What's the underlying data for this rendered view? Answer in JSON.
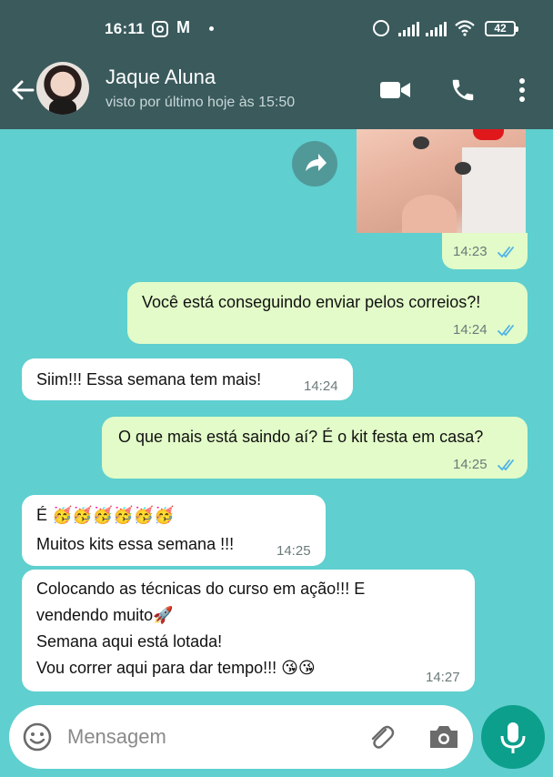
{
  "statusbar": {
    "time": "16:11",
    "mail_glyph": "M",
    "battery": "42"
  },
  "header": {
    "contact_name": "Jaque Aluna",
    "last_seen": "visto por último hoje às 15:50"
  },
  "messages": [
    {
      "type": "image",
      "direction": "out",
      "time": "14:23",
      "ticks": "read"
    },
    {
      "type": "text",
      "direction": "out",
      "text": "Você está conseguindo enviar pelos correios?!",
      "time": "14:24",
      "ticks": "read"
    },
    {
      "type": "text",
      "direction": "in",
      "text": "Siim!!! Essa semana tem mais!",
      "time": "14:24"
    },
    {
      "type": "text",
      "direction": "out",
      "text": "O que mais está saindo aí? É o kit festa em casa?",
      "time": "14:25",
      "ticks": "read"
    },
    {
      "type": "text",
      "direction": "in",
      "line1": "É 🥳🥳🥳🥳🥳🥳",
      "line2": "Muitos kits essa semana !!!",
      "time": "14:25"
    },
    {
      "type": "text",
      "direction": "in",
      "line1": "Colocando as técnicas do curso em ação!!! E",
      "line2": "vendendo muito🚀",
      "line3": "Semana aqui está lotada!",
      "line4": "Vou correr aqui para dar tempo!!! 😘😘",
      "time": "14:27"
    }
  ],
  "composer": {
    "placeholder": "Mensagem"
  },
  "colors": {
    "header_bg": "#3a5a5c",
    "chat_bg": "#5fcfcf",
    "outgoing_bubble": "#e2fbc8",
    "incoming_bubble": "#ffffff",
    "read_ticks": "#4fb3e8",
    "mic_button": "#0c9f8c"
  },
  "icons": [
    "instagram-icon",
    "mail-icon",
    "alarm-icon",
    "signal-icon",
    "wifi-icon",
    "battery-icon",
    "back-arrow-icon",
    "video-call-icon",
    "phone-icon",
    "more-vert-icon",
    "forward-icon",
    "emoji-icon",
    "attach-icon",
    "camera-icon",
    "mic-icon"
  ]
}
